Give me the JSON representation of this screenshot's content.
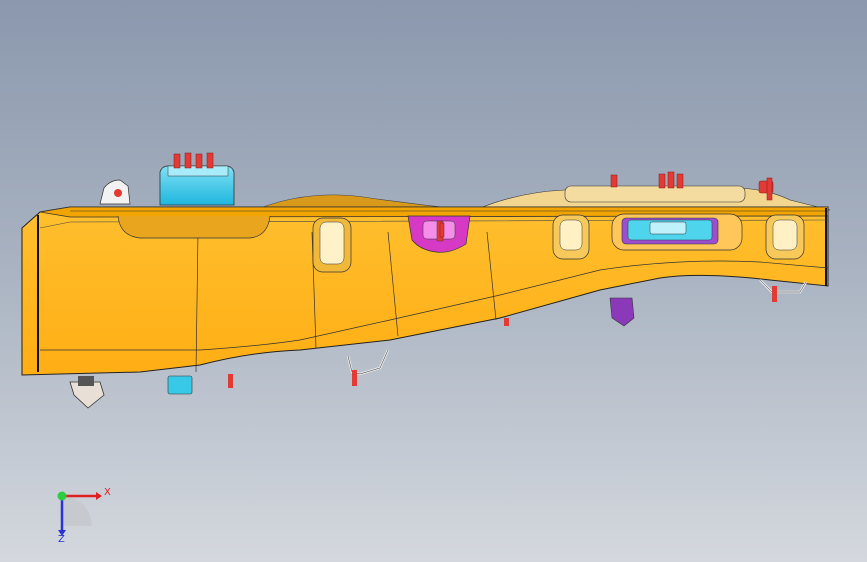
{
  "view": {
    "background_top": "#8b98ad",
    "background_bottom": "#d4d8de",
    "body_color": "#ffb31a",
    "top_flange_color": "#f6a700",
    "clip_cyan": "#39c9e8",
    "pin_red": "#e23a34",
    "clip_magenta": "#d83ac4",
    "clip_purple": "#8a3ab8"
  },
  "triad": {
    "x_label": "X",
    "z_label": "Z",
    "x_color": "#e02020",
    "z_color": "#2a34d6",
    "y_color": "#2ecc40"
  }
}
